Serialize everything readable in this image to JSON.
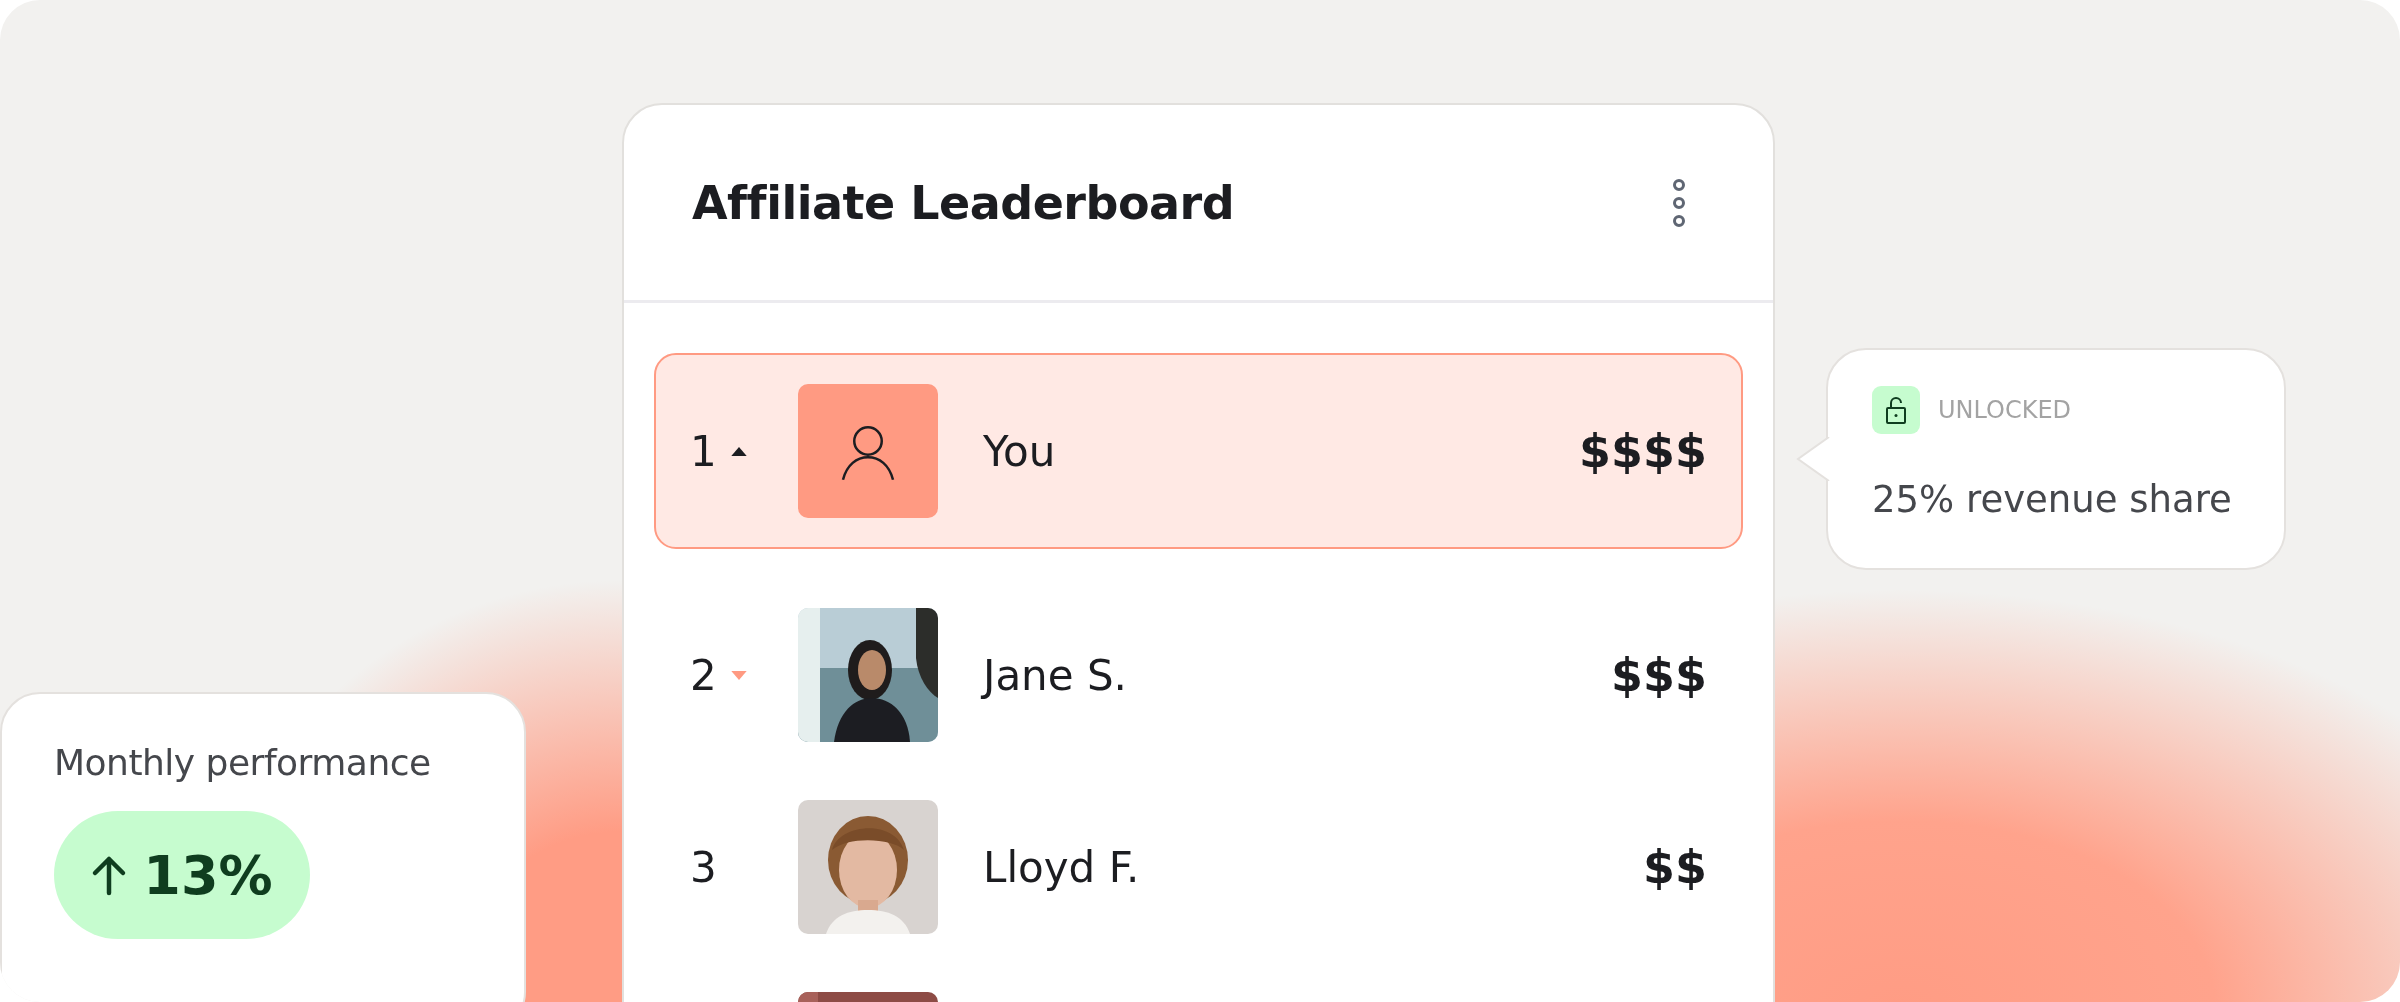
{
  "card": {
    "title": "Affiliate Leaderboard"
  },
  "rows": [
    {
      "kind": "icon",
      "rank": "1",
      "rising": true,
      "falling": false,
      "highlighted": true,
      "name": "You",
      "amount": "$$$$"
    },
    {
      "kind": "picture",
      "rank": "2",
      "rising": false,
      "falling": true,
      "highlighted": false,
      "name": "Jane S.",
      "amount": "$$$"
    },
    {
      "kind": "picture",
      "rank": "3",
      "rising": false,
      "falling": false,
      "highlighted": false,
      "name": "Lloyd F.",
      "amount": "$$"
    },
    {
      "kind": "picture"
    }
  ],
  "reward": {
    "status": "UNLOCKED",
    "text": "25% revenue share"
  },
  "performance": {
    "label": "Monthly performance",
    "change": "13%",
    "rising": true
  }
}
